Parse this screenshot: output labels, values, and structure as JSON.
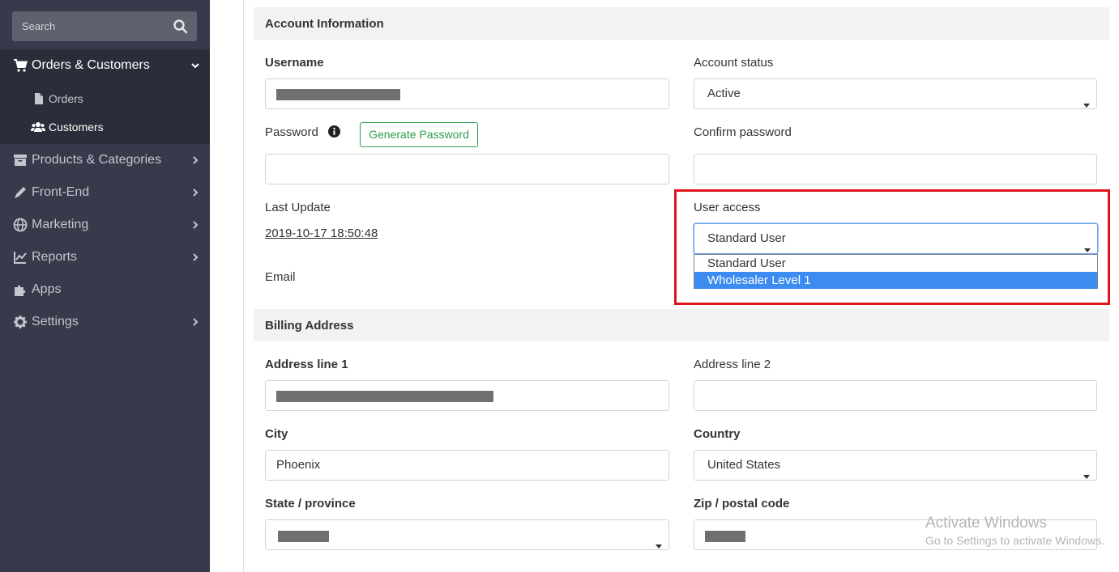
{
  "sidebar": {
    "search_placeholder": "Search",
    "menu": {
      "orders_customers": "Orders & Customers",
      "orders": "Orders",
      "customers": "Customers",
      "products_categories": "Products & Categories",
      "front_end": "Front-End",
      "marketing": "Marketing",
      "reports": "Reports",
      "apps": "Apps",
      "settings": "Settings"
    },
    "colors": {
      "bg": "#363a4a",
      "active_bg": "#2b2e3a"
    }
  },
  "account": {
    "section_title": "Account Information",
    "username_label": "Username",
    "account_status_label": "Account status",
    "account_status_value": "Active",
    "password_label": "Password",
    "generate_password_label": "Generate Password",
    "confirm_password_label": "Confirm password",
    "last_update_label": "Last Update",
    "last_update_value": "2019-10-17 18:50:48",
    "user_access_label": "User access",
    "user_access_value": "Standard User",
    "user_access_options": [
      "Standard User",
      "Wholesaler Level 1"
    ],
    "email_label": "Email"
  },
  "billing": {
    "section_title": "Billing Address",
    "address1_label": "Address line 1",
    "address2_label": "Address line 2",
    "city_label": "City",
    "city_value": "Phoenix",
    "country_label": "Country",
    "country_value": "United States",
    "state_label": "State / province",
    "zip_label": "Zip / postal code"
  },
  "watermark": {
    "line1": "Activate Windows",
    "line2": "Go to Settings to activate Windows."
  },
  "colors": {
    "highlight": "#e0141c",
    "button_green": "#2e9d4c",
    "option_selected": "#3b8bf0"
  }
}
